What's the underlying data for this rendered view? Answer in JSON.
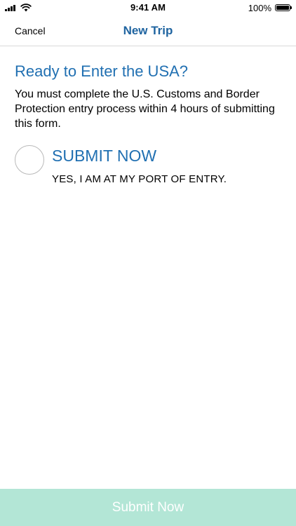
{
  "status_bar": {
    "time": "9:41 AM",
    "battery_percent": "100%",
    "battery_level": 1.0,
    "signal_icon": "signal-bars-icon",
    "wifi_icon": "wifi-icon",
    "battery_icon": "battery-icon"
  },
  "nav": {
    "cancel_label": "Cancel",
    "title": "New Trip",
    "title_color": "#1f64a0"
  },
  "content": {
    "heading": "Ready to Enter the USA?",
    "heading_color": "#2170b2",
    "description": "You must complete the U.S. Customs and Border Protection entry process within 4 hours of submitting this form."
  },
  "option": {
    "title": "SUBMIT NOW",
    "subtitle": "YES, I AM AT MY PORT OF ENTRY.",
    "selected": false
  },
  "footer": {
    "submit_label": "Submit Now",
    "button_color": "#b3e6d6",
    "enabled": false
  }
}
